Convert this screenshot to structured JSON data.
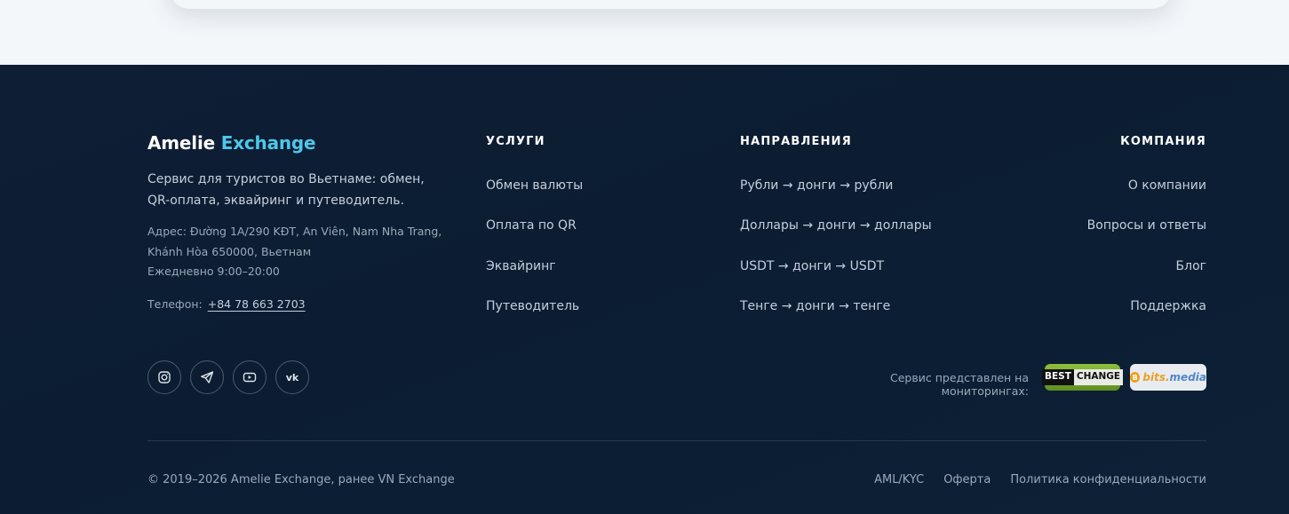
{
  "footer": {
    "brand": {
      "primary": "Amelie",
      "accent": "Exchange"
    },
    "description": "Сервис для туристов во Вьетнаме: обмен, QR-оплата, эквайринг и путеводитель.",
    "address": {
      "line1": "Адрес: Đường 1A/290 KĐT, An Viên, Nam Nha Trang,",
      "line2": "Khánh Hòa 650000, Вьетнам",
      "hours": "Ежедневно 9:00–20:00"
    },
    "phone": {
      "label": "Телефон:",
      "value": "+84 78 663 2703"
    },
    "columns": {
      "services": {
        "title": "УСЛУГИ",
        "items": [
          "Обмен валюты",
          "Оплата по QR",
          "Эквайринг",
          "Путеводитель"
        ]
      },
      "directions": {
        "title": "НАПРАВЛЕНИЯ",
        "items": [
          "Рубли → донги → рубли",
          "Доллары → донги → доллары",
          "USDT → донги → USDT",
          "Тенге → донги → тенге"
        ]
      },
      "company": {
        "title": "КОМПАНИЯ",
        "items": [
          "О компании",
          "Вопросы и ответы",
          "Блог",
          "Поддержка"
        ]
      }
    },
    "socials": [
      "instagram-icon",
      "telegram-icon",
      "youtube-icon",
      "vk-icon"
    ],
    "vk_glyph": "vk",
    "monitoring": {
      "label": "Сервис представлен на мониторингах:",
      "bestchange": {
        "part1": "BEST",
        "part2": "CHANGE"
      },
      "bitsmedia": {
        "coin": "B",
        "part1": "bits.",
        "part2": "media"
      }
    },
    "copyright": "© 2019–2026 Amelie Exchange, ранее VN Exchange",
    "legal": [
      "AML/KYC",
      "Оферта",
      "Политика конфиденциальности"
    ],
    "colors": {
      "background": "#0e1f35",
      "accent": "#4fc7e8"
    }
  }
}
